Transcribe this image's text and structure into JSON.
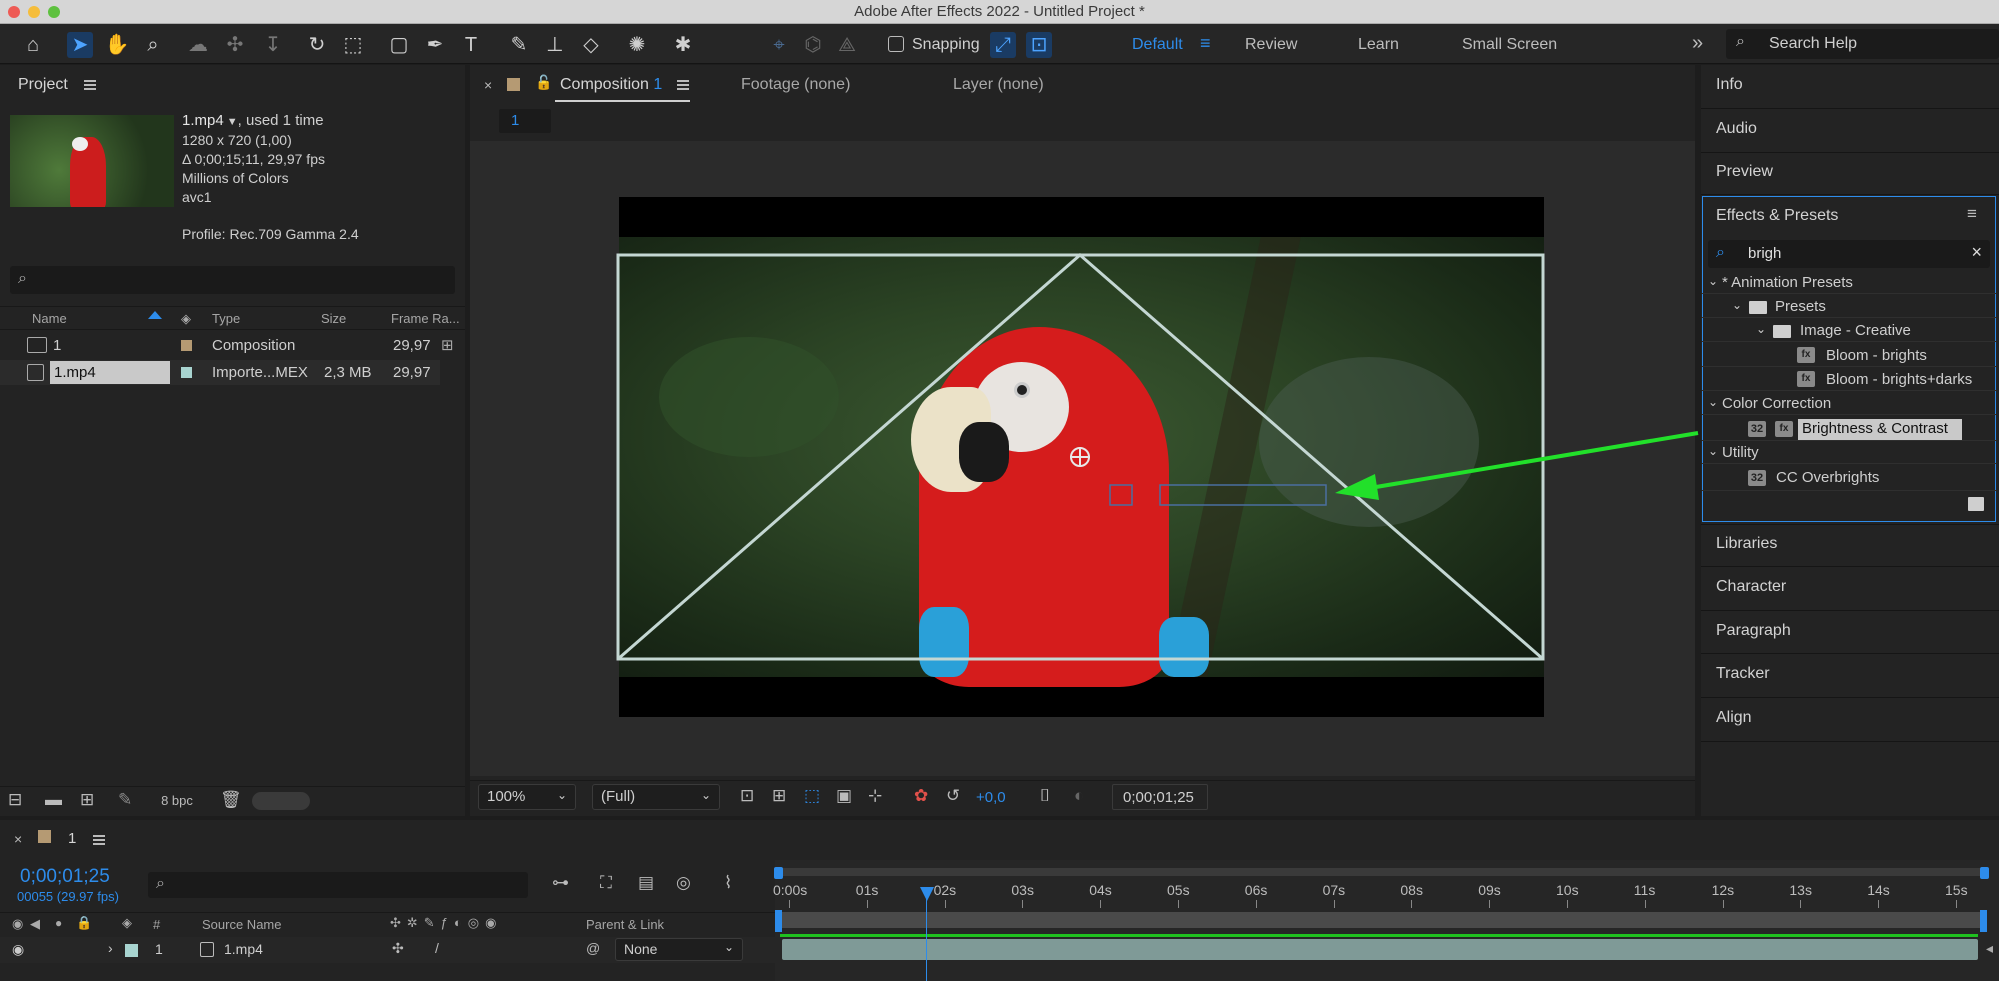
{
  "window": {
    "title": "Adobe After Effects 2022 - Untitled Project *"
  },
  "toolbar": {
    "snapping_label": "Snapping",
    "workspaces": [
      "Default",
      "Review",
      "Learn",
      "Small Screen"
    ],
    "search_placeholder": "Search Help"
  },
  "project": {
    "panel_title": "Project",
    "file_name": "1.mp4",
    "used": ", used 1 time",
    "resolution": "1280 x 720 (1,00)",
    "duration": "Δ 0;00;15;11, 29,97 fps",
    "colors": "Millions of Colors",
    "codec": "avc1",
    "profile": "Profile: Rec.709 Gamma 2.4",
    "columns": {
      "name": "Name",
      "type": "Type",
      "size": "Size",
      "frame_rate": "Frame Ra..."
    },
    "items": [
      {
        "name": "1",
        "type": "Composition",
        "size": "",
        "frame_rate": "29,97",
        "color": "#b59a73"
      },
      {
        "name": "1.mp4",
        "type": "Importe...MEX",
        "size": "2,3 MB",
        "frame_rate": "29,97",
        "color": "#a8d4d0"
      }
    ],
    "bpc": "8 bpc"
  },
  "composition": {
    "tab_label": "Composition",
    "tab_number": "1",
    "footage_tab": "Footage (none)",
    "layer_tab": "Layer (none)",
    "breadcrumb": "1",
    "zoom": "100%",
    "resolution": "(Full)",
    "exposure": "+0,0",
    "timecode": "0;00;01;25"
  },
  "right_panels": {
    "top": [
      "Info",
      "Audio",
      "Preview"
    ],
    "effects_title": "Effects & Presets",
    "search_value": "brigh",
    "tree": {
      "animation_presets": "* Animation Presets",
      "presets": "Presets",
      "image_creative": "Image - Creative",
      "bloom_brights": "Bloom - brights",
      "bloom_brights_darks": "Bloom - brights+darks",
      "color_correction": "Color Correction",
      "brightness_contrast": "Brightness & Contrast",
      "utility": "Utility",
      "cc_overbrights": "CC Overbrights",
      "badge": "32"
    },
    "bottom": [
      "Libraries",
      "Character",
      "Paragraph",
      "Tracker",
      "Align"
    ]
  },
  "timeline": {
    "comp_name": "1",
    "timecode": "0;00;01;25",
    "frame_info": "00055 (29.97 fps)",
    "columns": {
      "number": "#",
      "source_name": "Source Name",
      "parent_link": "Parent & Link"
    },
    "ruler": [
      "0:00s",
      "01s",
      "02s",
      "03s",
      "04s",
      "05s",
      "06s",
      "07s",
      "08s",
      "09s",
      "10s",
      "11s",
      "12s",
      "13s",
      "14s",
      "15s"
    ],
    "layer": {
      "index": "1",
      "name": "1.mp4",
      "parent": "None",
      "color": "#a8d4d0"
    }
  },
  "colors": {
    "accent": "#2d8ceb",
    "arrow": "#22e02a",
    "selection": "#c9c9c9",
    "green_bar": "#1fc11f"
  }
}
